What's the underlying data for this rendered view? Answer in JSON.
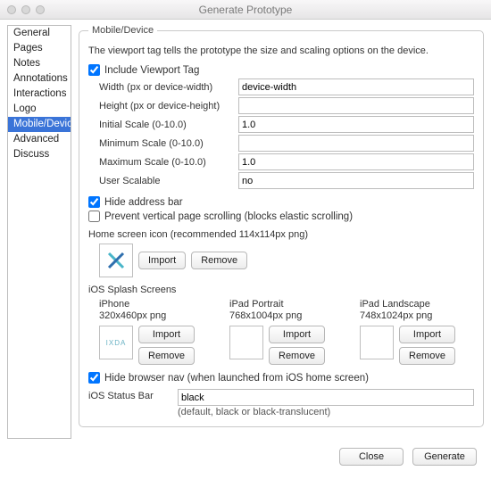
{
  "window": {
    "title": "Generate Prototype"
  },
  "sidebar": {
    "items": [
      {
        "label": "General"
      },
      {
        "label": "Pages"
      },
      {
        "label": "Notes"
      },
      {
        "label": "Annotations"
      },
      {
        "label": "Interactions"
      },
      {
        "label": "Logo"
      },
      {
        "label": "Mobile/Device"
      },
      {
        "label": "Advanced"
      },
      {
        "label": "Discuss"
      }
    ],
    "selected_index": 6
  },
  "group": {
    "legend": "Mobile/Device",
    "description": "The viewport tag tells the prototype the size and scaling options on the device.",
    "include_viewport": {
      "label": "Include Viewport Tag",
      "checked": true
    },
    "fields": {
      "width": {
        "label": "Width (px or device-width)",
        "value": "device-width"
      },
      "height": {
        "label": "Height (px or device-height)",
        "value": ""
      },
      "initial": {
        "label": "Initial Scale (0-10.0)",
        "value": "1.0"
      },
      "min": {
        "label": "Minimum Scale (0-10.0)",
        "value": ""
      },
      "max": {
        "label": "Maximum Scale (0-10.0)",
        "value": "1.0"
      },
      "scalable": {
        "label": "User Scalable",
        "value": "no"
      }
    },
    "hide_address": {
      "label": "Hide address bar",
      "checked": true
    },
    "prevent_scroll": {
      "label": "Prevent vertical page scrolling (blocks elastic scrolling)",
      "checked": false
    },
    "home_icon": {
      "label": "Home screen icon (recommended 114x114px png)",
      "import": "Import",
      "remove": "Remove"
    },
    "splash": {
      "heading": "iOS Splash Screens",
      "cols": [
        {
          "title": "iPhone",
          "dims": "320x460px png",
          "thumb_text": "IXDA"
        },
        {
          "title": "iPad Portrait",
          "dims": "768x1004px png",
          "thumb_text": ""
        },
        {
          "title": "iPad Landscape",
          "dims": "748x1024px png",
          "thumb_text": ""
        }
      ],
      "import": "Import",
      "remove": "Remove"
    },
    "hide_nav": {
      "label": "Hide browser nav (when launched from iOS home screen)",
      "checked": true
    },
    "status_bar": {
      "label": "iOS Status Bar",
      "value": "black",
      "hint": "(default, black or black-translucent)"
    }
  },
  "footer": {
    "close": "Close",
    "generate": "Generate"
  }
}
